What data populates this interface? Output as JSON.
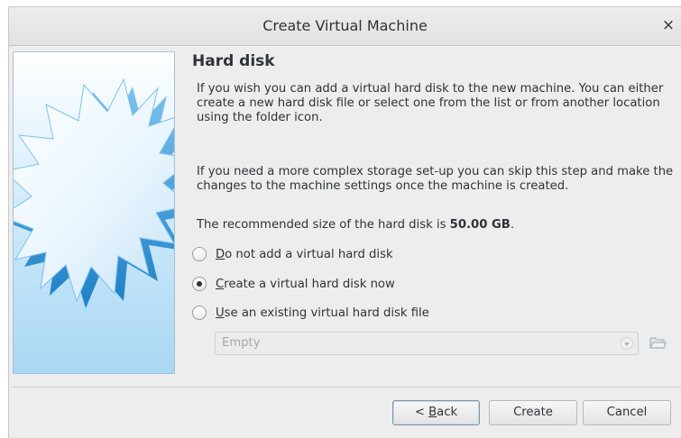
{
  "window": {
    "title": "Create Virtual Machine",
    "close_glyph": "×"
  },
  "page": {
    "heading": "Hard disk",
    "paragraph1": "If you wish you can add a virtual hard disk to the new machine. You can either create a new hard disk file or select one from the list or from another location using the folder icon.",
    "paragraph2": "If you need a more complex storage set-up you can skip this step and make the changes to the machine settings once the machine is created.",
    "recommended_prefix": "The recommended size of the hard disk is ",
    "recommended_size": "50.00 GB",
    "recommended_suffix": "."
  },
  "options": [
    {
      "mnemonic": "D",
      "rest": "o not add a virtual hard disk",
      "selected": false
    },
    {
      "mnemonic": "C",
      "rest": "reate a virtual hard disk now",
      "selected": true
    },
    {
      "mnemonic": "U",
      "rest": "se an existing virtual hard disk file",
      "selected": false
    }
  ],
  "disk_combo": {
    "value": "Empty",
    "enabled": false
  },
  "icons": {
    "banner": "starburst-graphic",
    "folder": "folder-open-icon",
    "close": "close-icon"
  },
  "buttons": {
    "back_prefix": "< ",
    "back_mnemonic": "B",
    "back_rest": "ack",
    "create": "Create",
    "cancel": "Cancel"
  },
  "colors": {
    "banner_blue": "#4aa3df",
    "window_bg": "#ededed",
    "default_button_border": "#7d95ad"
  }
}
